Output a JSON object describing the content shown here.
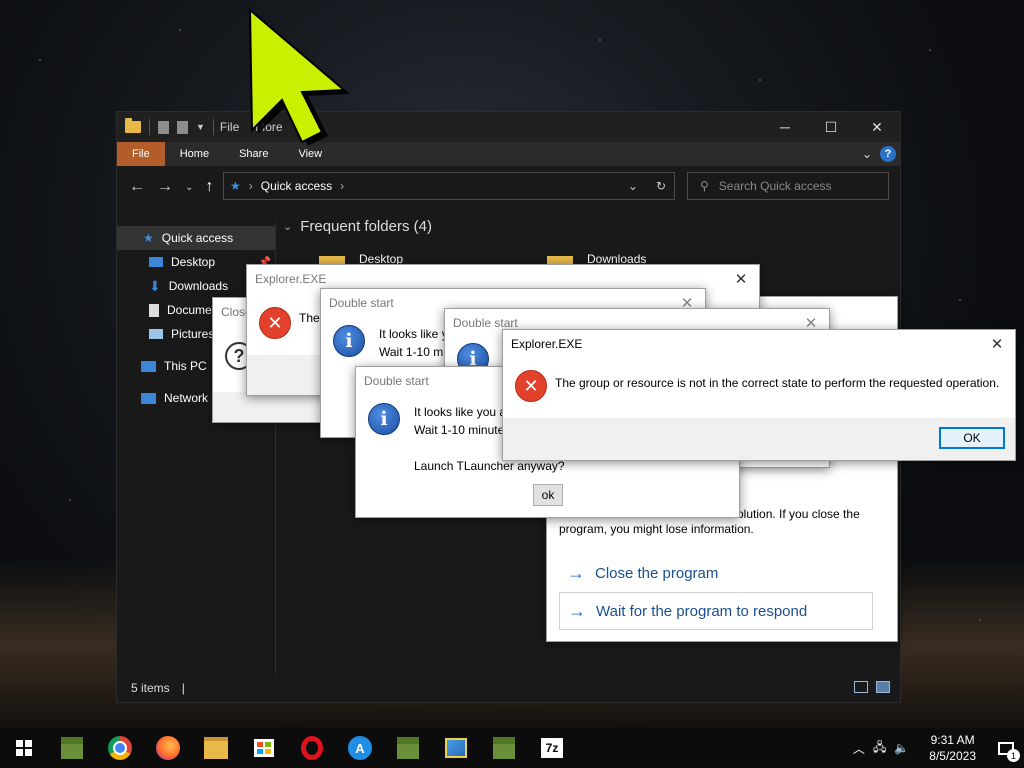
{
  "explorer": {
    "title": "File",
    "title_partial": "More",
    "ribbon_tabs": [
      "File",
      "Home",
      "Share",
      "View"
    ],
    "address": "Quick access",
    "search_placeholder": "Search Quick access",
    "sidebar": [
      {
        "label": "Quick access",
        "icon": "star-icon"
      },
      {
        "label": "Desktop",
        "icon": "desktop-icon"
      },
      {
        "label": "Downloads",
        "icon": "download-icon"
      },
      {
        "label": "Docume",
        "icon": "document-icon"
      },
      {
        "label": "Pictures",
        "icon": "pictures-icon"
      },
      {
        "label": "This PC",
        "icon": "computer-icon"
      },
      {
        "label": "Network",
        "icon": "network-icon"
      }
    ],
    "section_header": "Frequent folders (4)",
    "folders": [
      "Desktop",
      "Downloads"
    ],
    "status": "5 items"
  },
  "dialogs": {
    "close_partial": {
      "title": "Close"
    },
    "explorer_back": {
      "title": "Explorer.EXE",
      "message": "The"
    },
    "double_start_1": {
      "title": "Double start",
      "line1": "It looks like y",
      "line2": "Wait 1-10 mi"
    },
    "double_start_2": {
      "title": "Double start"
    },
    "double_start_3": {
      "title": "Double start",
      "line1": "It looks like you a",
      "line2": "Wait 1-10 minute",
      "line3": "Launch TLauncher anyway?",
      "ok_label": "ok"
    },
    "not_responding": {
      "line1": "olution. If you close the",
      "line2": "program, you might lose information.",
      "option1": "Close the program",
      "option2": "Wait for the program to respond"
    },
    "explorer_front": {
      "title": "Explorer.EXE",
      "message": "The group or resource is not in the correct state to perform the requested operation.",
      "ok_label": "OK"
    }
  },
  "taskbar": {
    "apps": [
      "windows-start-icon",
      "minecraft-icon",
      "chrome-icon",
      "firefox-icon",
      "file-explorer-icon",
      "store-icon",
      "opera-icon",
      "app-store-icon",
      "minecraft-icon",
      "control-panel-icon",
      "minecraft-icon",
      "7zip-icon"
    ],
    "time": "9:31 AM",
    "date": "8/5/2023",
    "notification_count": "1",
    "seven_zip": "7z"
  },
  "colors": {
    "file_tab": "#b25d2a",
    "cursor": "#c8f000",
    "link": "#1a4f8f",
    "error": "#e2412c"
  }
}
